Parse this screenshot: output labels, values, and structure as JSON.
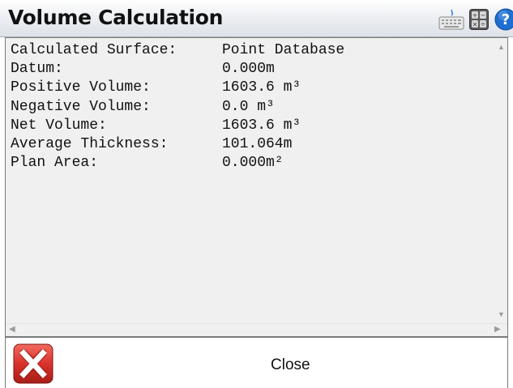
{
  "window": {
    "title": "Volume Calculation"
  },
  "toolbar": {
    "icons": [
      "keyboard-icon",
      "calculator-icon",
      "help-icon"
    ]
  },
  "report": {
    "rows": [
      {
        "label": "Calculated Surface:",
        "value": "Point Database"
      },
      {
        "label": "Datum:",
        "value": "0.000m"
      },
      {
        "label": "Positive Volume:",
        "value": "1603.6 m³"
      },
      {
        "label": "Negative Volume:",
        "value": "0.0 m³"
      },
      {
        "label": "Net Volume:",
        "value": "1603.6 m³"
      },
      {
        "label": "Average Thickness:",
        "value": "101.064m"
      },
      {
        "label": "Plan Area:",
        "value": "0.000m²"
      }
    ]
  },
  "footer": {
    "close_label": "Close"
  },
  "colors": {
    "close_red": "#d9322b",
    "help_blue": "#1f6fd0"
  }
}
